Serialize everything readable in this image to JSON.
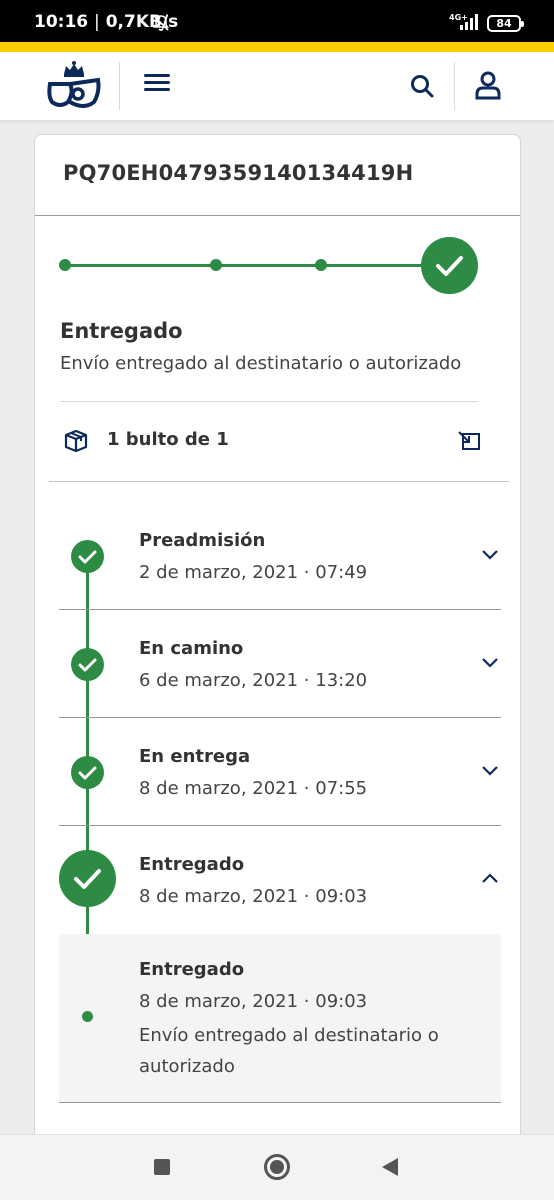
{
  "status_bar": {
    "time": "10:16",
    "separator": "|",
    "speed": "0,7KB/s",
    "network": "4G+",
    "battery": "84"
  },
  "colors": {
    "brand_yellow": "#ffcd00",
    "brand_navy": "#0b2a5b",
    "success_green": "#2e8b45"
  },
  "header": {
    "logo_icon": "correos-logo-icon",
    "menu_icon": "hamburger-menu-icon",
    "search_icon": "search-icon",
    "user_icon": "user-icon"
  },
  "shipment": {
    "tracking_number": "PQ70EH0479359140134419H",
    "progress_steps_completed": 4,
    "progress_steps_total": 4,
    "status_title": "Entregado",
    "status_description": "Envío entregado al destinatario o autorizado",
    "package_label": "1 bulto de 1"
  },
  "events": [
    {
      "title": "Preadmisión",
      "date": "2 de marzo, 2021 · 07:49",
      "expanded": false
    },
    {
      "title": "En camino",
      "date": "6 de marzo, 2021 · 13:20",
      "expanded": false
    },
    {
      "title": "En entrega",
      "date": "8 de marzo, 2021 · 07:55",
      "expanded": false
    },
    {
      "title": "Entregado",
      "date": "8 de marzo, 2021 · 09:03",
      "expanded": true
    }
  ],
  "event_detail": {
    "title": "Entregado",
    "date": "8 de marzo, 2021 · 09:03",
    "description": "Envío entregado al destinatario o autorizado"
  },
  "navbar": {
    "recents_icon": "square-recents-icon",
    "home_icon": "circle-home-icon",
    "back_icon": "triangle-back-icon"
  }
}
